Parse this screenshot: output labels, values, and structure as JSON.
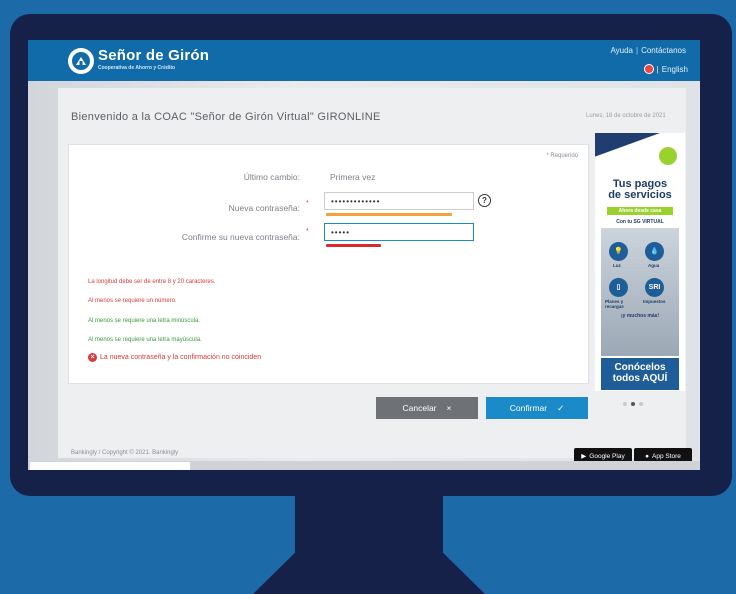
{
  "header": {
    "logo_name": "Señor de Girón",
    "logo_subtitle": "Cooperativa de Ahorro y Crédito",
    "help_link": "Ayuda",
    "contact_link": "Contáctanos",
    "language_label": "English"
  },
  "page": {
    "welcome_text": "Bienvenido a la COAC \"Señor de Girón Virtual\" GIRONLINE",
    "date_text": "Lunes, 18 de octubre de 2021"
  },
  "form": {
    "required_note": "* Requerido",
    "last_change_label": "Último cambio:",
    "last_change_value": "Primera vez",
    "new_password_label": "Nueva contraseña:",
    "new_password_value": "•••••••••••••",
    "confirm_password_label": "Confirme su nueva contraseña:",
    "confirm_password_value": "•••••",
    "help_glyph": "?",
    "new_strength": 0.86,
    "confirm_strength": 0.38,
    "strength_colors": {
      "medium": "#f2a23a",
      "weak": "#d92b2b"
    }
  },
  "rules": [
    {
      "text": "La longitud debe ser de entre 8 y 20 caracteres.",
      "status": "error"
    },
    {
      "text": "Al menos se requiere un número.",
      "status": "error"
    },
    {
      "text": "Al menos se requiere una letra minúscula.",
      "status": "ok"
    },
    {
      "text": "Al menos se requiere una letra mayúscula.",
      "status": "ok"
    }
  ],
  "error_message": "La nueva contraseña y la confirmación no coinciden",
  "buttons": {
    "cancel_label": "Cancelar",
    "cancel_icon": "×",
    "confirm_label": "Confirmar",
    "confirm_icon": "✓"
  },
  "ad": {
    "title_line1": "Tus pagos",
    "title_line2": "de servicios",
    "green_banner": "Ahora desde casa",
    "subtitle": "Con tu SG VIRTUAL",
    "icons": [
      {
        "glyph": "💡",
        "label": "Luz"
      },
      {
        "glyph": "💧",
        "label": "Agua"
      },
      {
        "glyph": "▯",
        "label": "Planes y recargas"
      },
      {
        "glyph": "SRI",
        "label": "Impuestos"
      }
    ],
    "more_text": "¡y muchos más!",
    "bottom_line1": "Conócelos",
    "bottom_line2": "todos AQUÍ",
    "carousel_active": 2
  },
  "footer": {
    "copyright": "Bankingly / Copyright © 2021. Bankingly",
    "google_play": "Google Play",
    "app_store": "App Store"
  },
  "colors": {
    "background": "#1d6aa8",
    "monitor": "#16214a",
    "brand_blue": "#116ba8",
    "confirm_blue": "#1b8ac9",
    "cancel_grey": "#6e7176",
    "error_red": "#d93a3a",
    "ok_green": "#3c9a3c"
  }
}
